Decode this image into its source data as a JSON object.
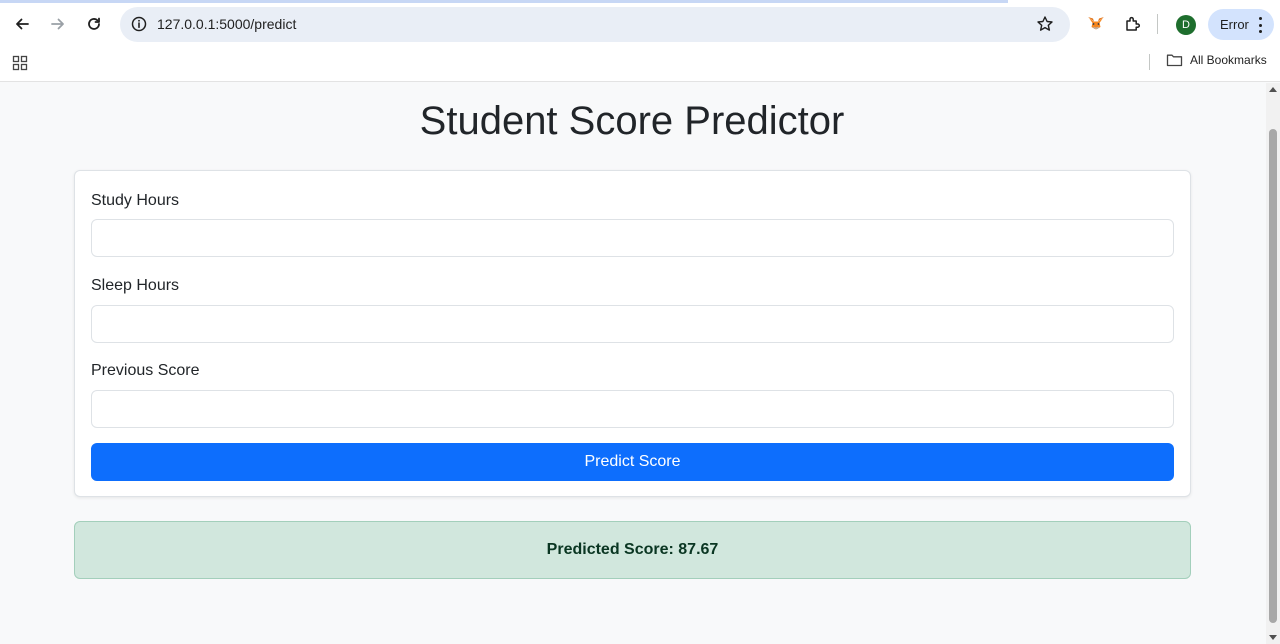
{
  "browser": {
    "url": "127.0.0.1:5000/predict",
    "avatar_initial": "D",
    "profile_chip_label": "Error",
    "bookmarks_label": "All Bookmarks"
  },
  "page": {
    "title": "Student Score Predictor",
    "form": {
      "study_hours_label": "Study Hours",
      "sleep_hours_label": "Sleep Hours",
      "previous_score_label": "Previous Score",
      "study_hours_value": "",
      "sleep_hours_value": "",
      "previous_score_value": "",
      "submit_label": "Predict Score"
    },
    "result_text": "Predicted Score: 87.67"
  },
  "colors": {
    "primary": "#0d6efd",
    "success_bg": "#d1e7dd",
    "success_text": "#0a3622",
    "avatar": "#1e6e2d"
  }
}
